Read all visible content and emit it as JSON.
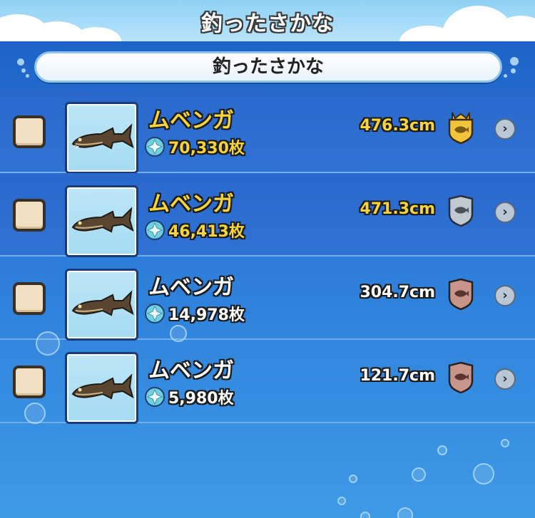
{
  "header": {
    "title": "釣ったさかな"
  },
  "section": {
    "title": "釣ったさかな"
  },
  "colors": {
    "gold_text": "#f7d43a",
    "white_text": "#ffffff",
    "gold_medal": "#f2c43b",
    "silver_medal": "#c0c8d2",
    "bronze_medal": "#c9958a"
  },
  "rows": [
    {
      "name": "ムベンガ",
      "price": "70,330枚",
      "size": "476.3cm",
      "medal": "gold-crown-medal-icon"
    },
    {
      "name": "ムベンガ",
      "price": "46,413枚",
      "size": "471.3cm",
      "medal": "silver-medal-icon"
    },
    {
      "name": "ムベンガ",
      "price": "14,978枚",
      "size": "304.7cm",
      "medal": "bronze-medal-icon"
    },
    {
      "name": "ムベンガ",
      "price": "5,980枚",
      "size": "121.7cm",
      "medal": "bronze-medal-icon"
    }
  ]
}
